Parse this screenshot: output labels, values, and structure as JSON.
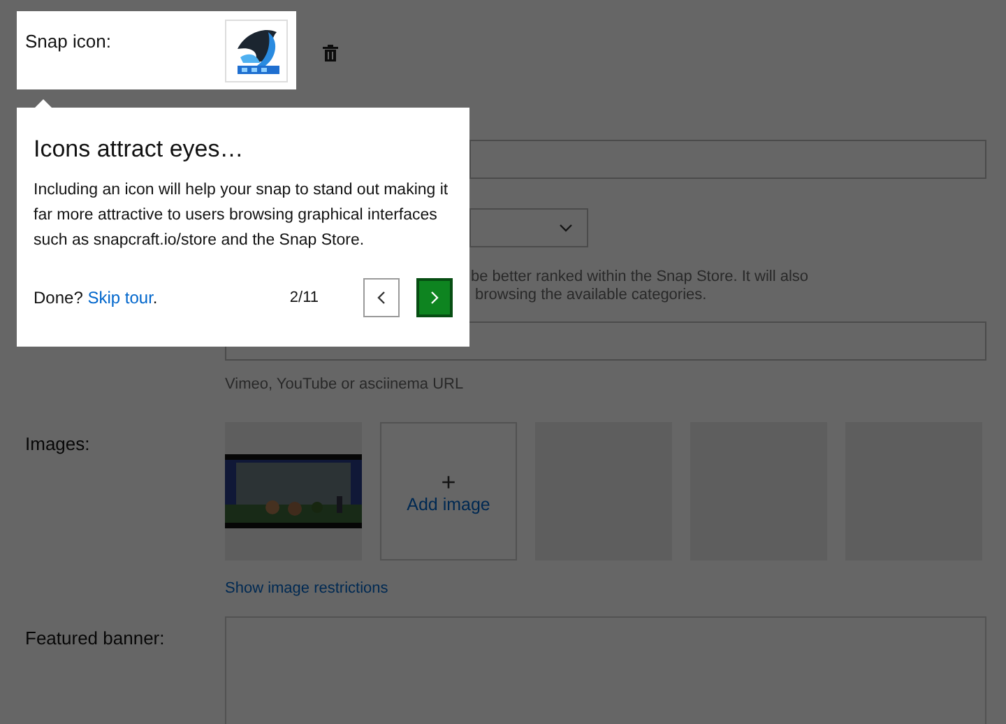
{
  "snap_icon": {
    "label": "Snap icon:",
    "kind": "picture",
    "highlighted": true
  },
  "summary_field": {
    "kind": "text"
  },
  "category_select": {
    "kind": "select"
  },
  "category_help": [
    "be better ranked within the Snap Store. It will also",
    "browsing the available categories."
  ],
  "video_field": {
    "caption": "Vimeo, YouTube or asciinema URL"
  },
  "images": {
    "label": "Images:",
    "tiles": [
      {
        "kind": "screenshot"
      },
      {
        "kind": "add",
        "glyph": "+",
        "text": "Add image"
      },
      {
        "kind": "empty"
      },
      {
        "kind": "empty"
      },
      {
        "kind": "empty"
      }
    ],
    "restrictions_link": "Show image restrictions"
  },
  "featured_banner": {
    "label": "Featured banner:"
  },
  "tour": {
    "title": "Icons attract eyes…",
    "body": "Including an icon will help your snap to stand out making it far more attractive to users browsing graphical interfaces such as snapcraft.io/store and the Snap Store.",
    "done": "Done?",
    "skip_link": "Skip tour",
    "skip_suffix": ".",
    "step": "2/11"
  }
}
